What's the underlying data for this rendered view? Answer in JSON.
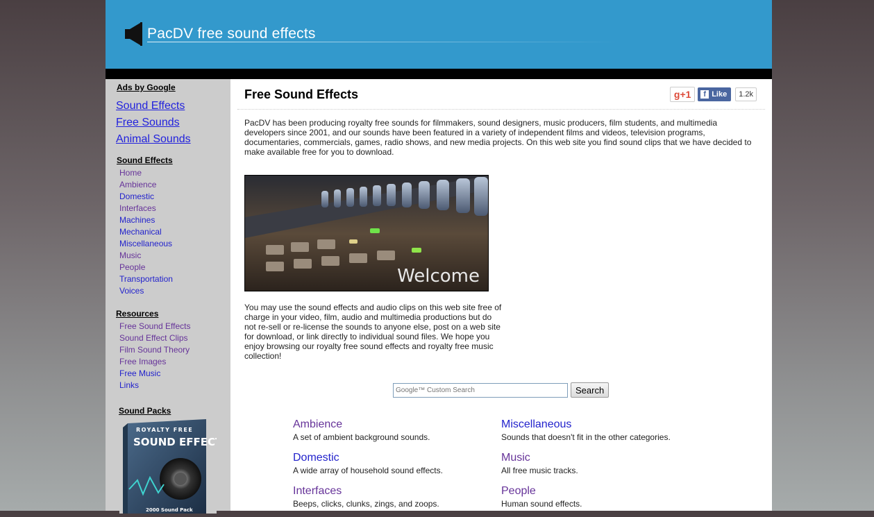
{
  "header": {
    "title": "PacDV free sound effects"
  },
  "sidebar": {
    "ads_heading": "Ads by Google",
    "ads_links": [
      "Sound Effects",
      "Free Sounds",
      "Animal Sounds"
    ],
    "sound_effects_heading": "Sound Effects",
    "sound_effects_items": [
      "Home",
      "Ambience",
      "Domestic",
      "Interfaces",
      "Machines",
      "Mechanical",
      "Miscellaneous",
      "Music",
      "People",
      "Transportation",
      "Voices"
    ],
    "resources_heading": "Resources",
    "resources_items": [
      "Free Sound Effects",
      "Sound Effect Clips",
      "Film Sound Theory",
      "Free Images",
      "Free Music",
      "Links"
    ],
    "sound_packs_heading": "Sound Packs",
    "sound_pack_box": {
      "line1": "ROYALTY FREE",
      "line2": "SOUND EFFECTS",
      "line3": "2000 Sound Pack"
    }
  },
  "main": {
    "title": "Free Sound Effects",
    "social": {
      "gplus": "g+1",
      "like": "Like",
      "like_count": "1.2k"
    },
    "intro": "PacDV has been producing royalty free sounds for filmmakers, sound designers, music producers, film students, and multimedia developers since 2001, and our sounds have been featured in a variety of independent films and videos, television programs, documentaries, commercials, games, radio shows, and new media projects. On this web site you find sound clips that we have decided to make available free for you to download.",
    "welcome_text": "Welcome",
    "usage": "You may use the sound effects and audio clips on this web site free of charge in your video, film, audio and multimedia productions but do not re-sell or re-license the sounds to anyone else, post on a web site for download, or link directly to individual sound files. We hope you enjoy browsing our royalty free sound effects and royalty free music collection!",
    "search": {
      "placeholder": "Google™ Custom Search",
      "button": "Search"
    },
    "categories": [
      {
        "name": "Ambience",
        "desc": "A set of ambient background sounds."
      },
      {
        "name": "Miscellaneous",
        "desc": "Sounds that doesn't fit in the other categories."
      },
      {
        "name": "Domestic",
        "desc": "A wide array of household sound effects."
      },
      {
        "name": "Music",
        "desc": "All free music tracks."
      },
      {
        "name": "Interfaces",
        "desc": "Beeps, clicks, clunks, zings, and zoops."
      },
      {
        "name": "People",
        "desc": "Human sound effects."
      }
    ]
  },
  "colors": {
    "header": "#3399cc",
    "sidebar": "#cccccc",
    "link_blue": "#2222cc",
    "link_visited": "#663399"
  }
}
